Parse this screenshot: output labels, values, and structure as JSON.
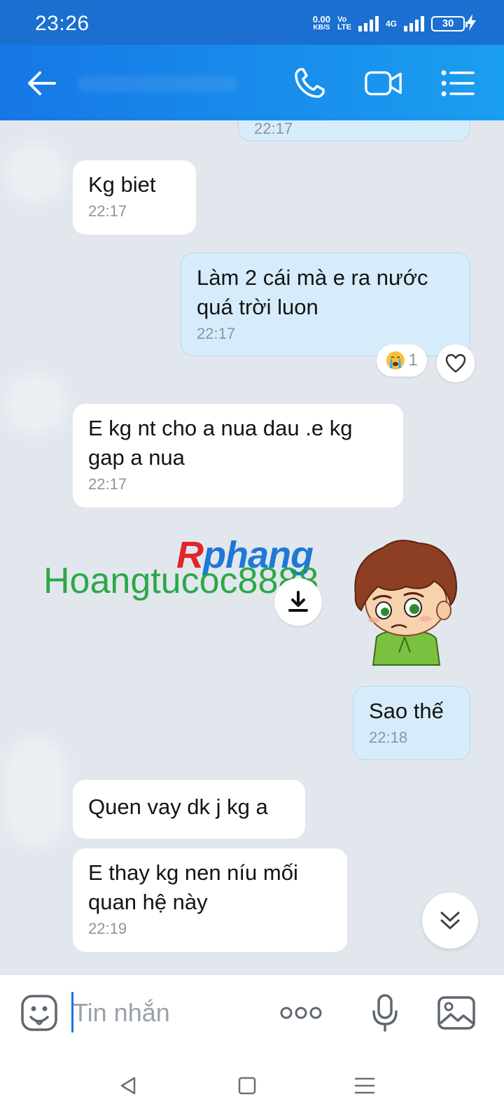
{
  "status_bar": {
    "time": "23:26",
    "speed_value": "0.00",
    "speed_unit": "KB/S",
    "volte_line1": "Vo",
    "volte_line2": "LTE",
    "network": "4G",
    "battery": "30"
  },
  "header": {
    "contact_name": "",
    "back_icon": "arrow-left-icon",
    "call_icon": "phone-icon",
    "video_icon": "video-camera-icon",
    "menu_icon": "list-menu-icon"
  },
  "messages": [
    {
      "direction": "out",
      "text": "",
      "time": "22:17"
    },
    {
      "direction": "in",
      "text": "Kg biet",
      "time": "22:17"
    },
    {
      "direction": "out",
      "text": "Làm 2 cái mà e ra nước\nquá trời luon",
      "time": "22:17",
      "reaction_count": "1"
    },
    {
      "direction": "in",
      "text": "E kg nt cho a nua dau .e kg\ngap a nua",
      "time": "22:17"
    },
    {
      "direction": "out",
      "text": "Sao thế",
      "time": "22:18"
    },
    {
      "direction": "in",
      "text": "Quen vay dk j kg a",
      "time": ""
    },
    {
      "direction": "in",
      "text": "E thay kg nen níu mối\nquan hệ này",
      "time": "22:19"
    }
  ],
  "watermark": {
    "brand_r": "R",
    "brand_rest": "phang",
    "handle": "Hoangtucoc8888"
  },
  "input_bar": {
    "placeholder": "Tin nhắn"
  },
  "colors": {
    "header": "#1a8de8",
    "status_bar": "#1a6fd1",
    "chat_bg": "#e2e7ee",
    "bubble_out": "#d6ecfb",
    "bubble_in": "#ffffff"
  }
}
